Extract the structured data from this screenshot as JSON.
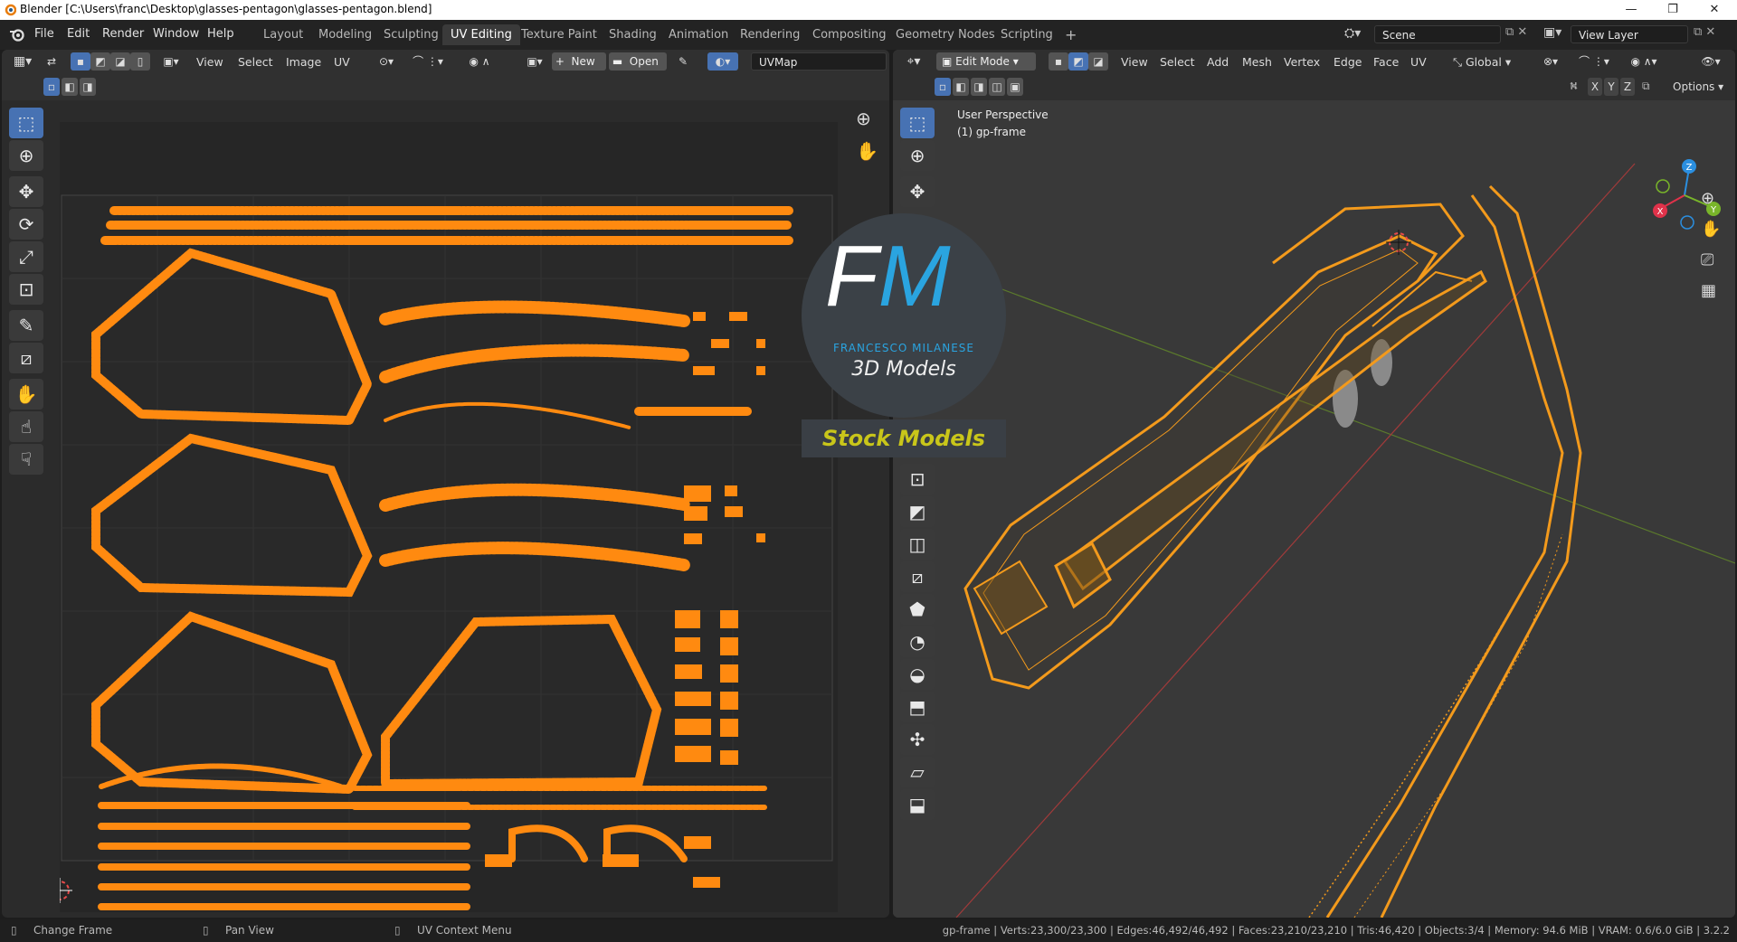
{
  "window": {
    "title": "Blender [C:\\Users\\franc\\Desktop\\glasses-pentagon\\glasses-pentagon.blend]",
    "controls": [
      "—",
      "❐",
      "✕"
    ]
  },
  "menubar": {
    "menus": [
      "File",
      "Edit",
      "Render",
      "Window",
      "Help"
    ],
    "workspaces": [
      "Layout",
      "Modeling",
      "Sculpting",
      "UV Editing",
      "Texture Paint",
      "Shading",
      "Animation",
      "Rendering",
      "Compositing",
      "Geometry Nodes",
      "Scripting"
    ],
    "active_workspace": "UV Editing",
    "add_tab": "+",
    "scene": "Scene",
    "view_layer": "View Layer"
  },
  "uv_editor": {
    "menus": [
      "View",
      "Select",
      "Image",
      "UV"
    ],
    "new_label": "New",
    "open_label": "Open",
    "uvmap": "UVMap"
  },
  "viewport": {
    "mode": "Edit Mode",
    "menus": [
      "View",
      "Select",
      "Add",
      "Mesh",
      "Vertex",
      "Edge",
      "Face",
      "UV"
    ],
    "transform_orientation": "Global",
    "axes": [
      "X",
      "Y",
      "Z"
    ],
    "options_label": "Options",
    "overlay_line1": "User Perspective",
    "overlay_line2": "(1) gp-frame"
  },
  "watermark": {
    "logo_letters": "FM",
    "brand": "FRANCESCO MILANESE",
    "subtitle": "3D Models",
    "banner": "Stock Models"
  },
  "statusbar": {
    "hint1": "Change Frame",
    "hint2": "Pan View",
    "hint3": "UV Context Menu",
    "stats": "gp-frame | Verts:23,300/23,300 | Edges:46,492/46,492 | Faces:23,210/23,210 | Tris:46,420 | Objects:3/4 | Memory: 94.6 MiB | VRAM: 0.6/6.0 GiB | 3.2.2"
  },
  "colors": {
    "accent": "#4772b3",
    "uv_orange": "#ff8a10",
    "mesh_orange": "#f39a1c",
    "banner_text": "#c9c61a",
    "logo_blue": "#2aa4e0"
  }
}
